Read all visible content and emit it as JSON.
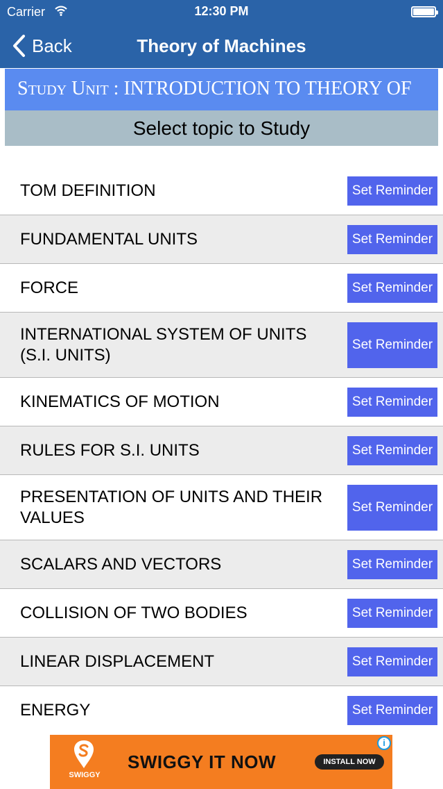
{
  "status_bar": {
    "carrier": "Carrier",
    "time": "12:30 PM"
  },
  "nav": {
    "back_label": "Back",
    "title": "Theory of Machines"
  },
  "unit_banner": {
    "label": "Study Unit : INTRODUCTION TO THEORY OF"
  },
  "topic_prompt": "Select topic to Study",
  "reminder_label": "Set Reminder",
  "topics": [
    {
      "title": "TOM DEFINITION"
    },
    {
      "title": "FUNDAMENTAL UNITS"
    },
    {
      "title": "FORCE"
    },
    {
      "title": "INTERNATIONAL SYSTEM OF UNITS (S.I. UNITS)"
    },
    {
      "title": "KINEMATICS OF MOTION"
    },
    {
      "title": "RULES FOR S.I. UNITS"
    },
    {
      "title": "PRESENTATION OF UNITS AND THEIR VALUES"
    },
    {
      "title": "SCALARS AND VECTORS"
    },
    {
      "title": "COLLISION OF TWO BODIES"
    },
    {
      "title": "LINEAR DISPLACEMENT"
    },
    {
      "title": "ENERGY"
    }
  ],
  "ad": {
    "brand": "SWIGGY",
    "headline": "SWIGGY IT NOW",
    "cta": "INSTALL NOW",
    "info_glyph": "i"
  },
  "colors": {
    "nav_bar": "#2a63a8",
    "unit_banner": "#5a8bf0",
    "topic_prompt": "#a9bdc7",
    "reminder_button": "#5164ec",
    "row_alt": "#ececec",
    "ad_background": "#f47d20"
  },
  "icons": {
    "wifi": "wifi-icon",
    "battery": "battery-icon",
    "back": "chevron-left-icon",
    "ad_logo": "swiggy-logo-icon",
    "ad_info": "info-icon"
  }
}
